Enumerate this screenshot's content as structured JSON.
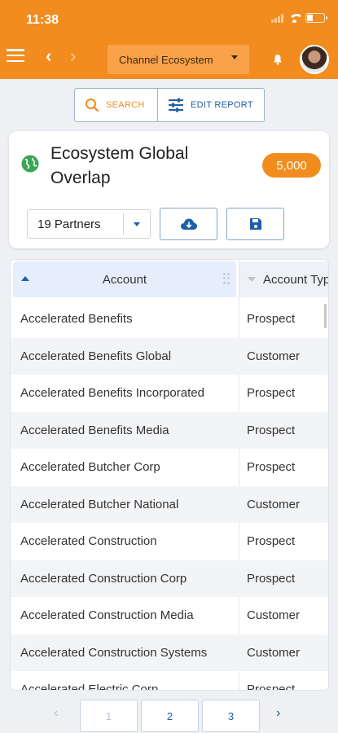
{
  "status_bar": {
    "time": "11:38"
  },
  "header": {
    "channel_select": "Channel Ecosystem",
    "icons": [
      "menu-icon",
      "back-arrow-icon",
      "forward-arrow-icon",
      "bell-icon",
      "avatar"
    ]
  },
  "actions": {
    "search_label": "SEARCH",
    "edit_report_label": "EDIT REPORT"
  },
  "report": {
    "title": "Ecosystem Global Overlap",
    "count": "5,000",
    "partners_select": "19 Partners",
    "icons": [
      "globe-icon",
      "cloud-download-icon",
      "save-icon"
    ]
  },
  "table": {
    "columns": [
      "Account",
      "Account Type"
    ],
    "rows": [
      [
        "Accelerated Benefits",
        "Prospect"
      ],
      [
        "Accelerated Benefits Global",
        "Customer"
      ],
      [
        "Accelerated Benefits Incorporated",
        "Prospect"
      ],
      [
        "Accelerated Benefits Media",
        "Prospect"
      ],
      [
        "Accelerated Butcher Corp",
        "Prospect"
      ],
      [
        "Accelerated Butcher National",
        "Customer"
      ],
      [
        "Accelerated Construction",
        "Prospect"
      ],
      [
        "Accelerated Construction Corp",
        "Prospect"
      ],
      [
        "Accelerated Construction Media",
        "Customer"
      ],
      [
        "Accelerated Construction Systems",
        "Customer"
      ],
      [
        "Accelerated Electric Corp",
        "Prospect"
      ]
    ]
  },
  "pagination": {
    "pages": [
      "1",
      "2",
      "3"
    ],
    "prev": "‹",
    "next": "›"
  },
  "colors": {
    "brand_orange": "#f28c1e",
    "link_blue": "#1f5fa8"
  }
}
